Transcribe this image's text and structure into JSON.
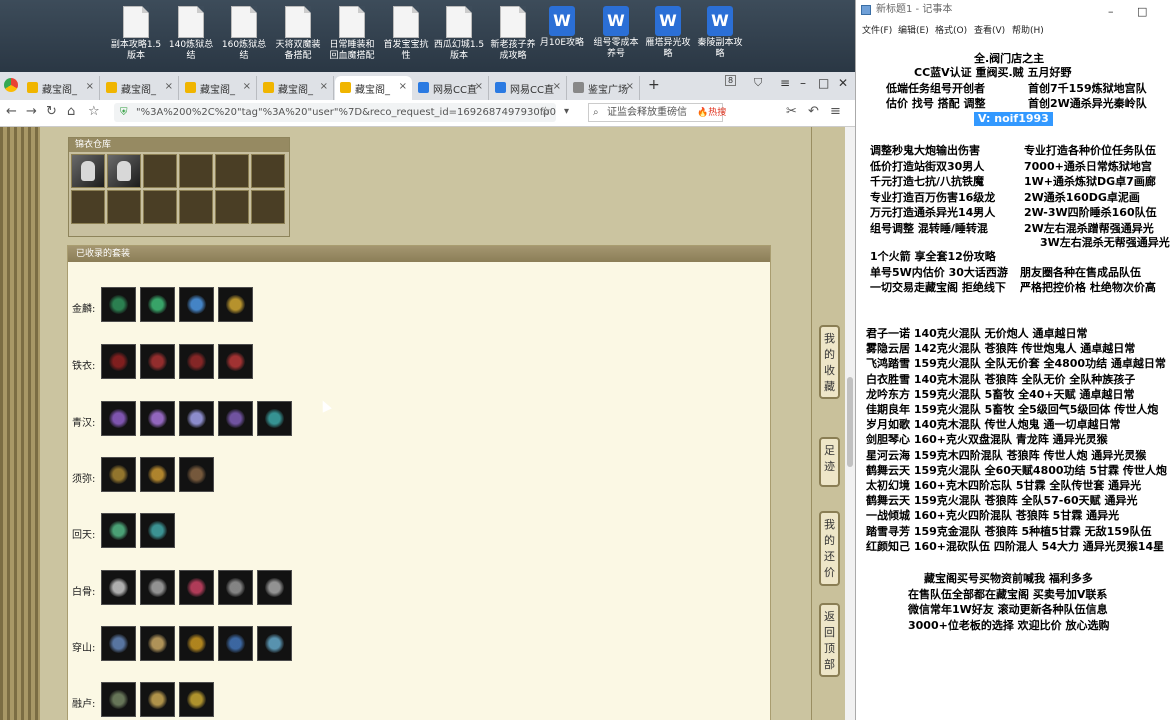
{
  "desktop": {
    "icons": [
      {
        "label": "副本攻略1.5版本",
        "type": "doc"
      },
      {
        "label": "140炼狱总结",
        "type": "doc"
      },
      {
        "label": "160炼狱总结",
        "type": "doc"
      },
      {
        "label": "天将双魔装备搭配",
        "type": "doc"
      },
      {
        "label": "日常睡装和回血魔搭配",
        "type": "doc"
      },
      {
        "label": "首发宝宝抗性",
        "type": "doc"
      },
      {
        "label": "西瓜幻城1.5版本",
        "type": "doc"
      },
      {
        "label": "新老孩子养成攻略",
        "type": "doc"
      },
      {
        "label": "月10E攻略",
        "type": "wps"
      },
      {
        "label": "组号零成本养号",
        "type": "wps"
      },
      {
        "label": "雁塔异光攻略",
        "type": "wps"
      },
      {
        "label": "秦陵副本攻略",
        "type": "wps"
      }
    ]
  },
  "browser": {
    "tabs": [
      {
        "label": "藏宝阁_",
        "active": false
      },
      {
        "label": "藏宝阁_",
        "active": false
      },
      {
        "label": "藏宝阁_",
        "active": false
      },
      {
        "label": "藏宝阁_",
        "active": false
      },
      {
        "label": "藏宝阁_",
        "active": true
      },
      {
        "label": "网易CC直",
        "active": false
      },
      {
        "label": "网易CC直",
        "active": false
      },
      {
        "label": "鉴宝广场",
        "active": false
      }
    ],
    "tab_count": "8",
    "url": "\"%3A%200%2C%20\"tag\"%3A%20\"user\"%7D&reco_request_id=1692687497930fp0oQ",
    "search_placeholder": "证监会释放重磅信",
    "search_hot": "热搜"
  },
  "game": {
    "warehouse_title": "锦衣仓库",
    "warehouse_items": 2,
    "panel_title": "已收录的套装",
    "rows": [
      {
        "label": "金麟:",
        "count": 4,
        "colors": [
          "#2e8b57",
          "#3cb371",
          "#4a90d9",
          "#c8a030"
        ]
      },
      {
        "label": "铁衣:",
        "count": 4,
        "colors": [
          "#8b2020",
          "#a03030",
          "#902828",
          "#b03535"
        ]
      },
      {
        "label": "青汉:",
        "count": 5,
        "colors": [
          "#8a5cc0",
          "#a070d0",
          "#9a9ae0",
          "#7a5ab0",
          "#3aa0a0"
        ]
      },
      {
        "label": "须弥:",
        "count": 3,
        "colors": [
          "#a08030",
          "#c09030",
          "#806040"
        ]
      },
      {
        "label": "回天:",
        "count": 2,
        "colors": [
          "#50b080",
          "#40a0a0"
        ]
      },
      {
        "label": "白骨:",
        "count": 5,
        "colors": [
          "#c0c0c0",
          "#a0a0a0",
          "#c04060",
          "#909090",
          "#a0a0a0"
        ]
      },
      {
        "label": "穿山:",
        "count": 5,
        "colors": [
          "#6080b0",
          "#c0a060",
          "#c09020",
          "#4070b0",
          "#60a0c0"
        ]
      },
      {
        "label": "融卢:",
        "count": 3,
        "colors": [
          "#708060",
          "#c0a050",
          "#c0a030"
        ]
      }
    ],
    "nav": [
      {
        "label": "我的收藏"
      },
      {
        "label": "足迹"
      },
      {
        "label": "我的还价"
      },
      {
        "label": "返回顶部"
      }
    ]
  },
  "notepad": {
    "title": "新标题1 - 记事本",
    "menu": [
      "文件(F)",
      "编辑(E)",
      "格式(O)",
      "查看(V)",
      "帮助(H)"
    ],
    "top_lines": [
      "全.阀门店之主",
      "CC蓝V认证  重阀买.贼  五月好野"
    ],
    "top_pairs": [
      [
        "低端任务组号开创者",
        "首创7千159炼狱地宫队"
      ],
      [
        "估价 找号 搭配 调整",
        "首创2W通杀异光秦岭队"
      ]
    ],
    "vtag": "V:  noif1993",
    "pairs": [
      [
        "调整秒鬼大炮输出伤害",
        "专业打造各种价位任务队伍"
      ],
      [
        "低价打造站街双30男人",
        "7000+通杀日常炼狱地宫"
      ],
      [
        "千元打造七抗/八抗铁魔",
        "1W+通杀炼狱DG卓7画廊"
      ],
      [
        "专业打造百万伤害16级龙",
        "2W通杀160DG卓泥画"
      ],
      [
        "万元打造通杀异光14男人",
        "2W-3W四阶睡杀160队伍"
      ],
      [
        "组号调整 混转睡/睡转混",
        "2W左右混杀蹭帮强通异光"
      ]
    ],
    "pair_tail": "3W左右混杀无帮强通异光",
    "mid_lines": [
      "1个火箭 享全套12份攻略"
    ],
    "mid_pairs": [
      [
        "单号5W内估价 30大话西游",
        "朋友圈各种在售成品队伍"
      ],
      [
        "一切交易走藏宝阁 拒绝线下",
        "严格把控价格 杜绝物次价高"
      ]
    ],
    "list": [
      "君子一诺 140克火混队 无价炮人 通卓越日常",
      "雾隐云居 142克火混队 苍狼阵 传世炮鬼人 通卓越日常",
      "飞鸿踏雪 159克火混队 全队无价套 全4800功结 通卓越日常",
      "白衣胜雪 140克木混队 苍狼阵 全队无价 全队种族孩子",
      "龙吟东方 159克火混队 5畜牧 全40+天赋 通卓越日常",
      "佳期良年 159克火混队 5畜牧 全5级回气5级回体 传世人炮",
      "岁月如歌 140克木混队 传世人炮鬼 通一切卓越日常",
      "剑胆琴心 160+克火双盘混队 青龙阵 通异光灵猴",
      "星河云海 159克木四阶混队 苍狼阵 传世人炮 通异光灵猴",
      "鹤舞云天 159克火混队 全60天赋4800功结 5甘霖 传世人炮",
      "太初幻境 160+克木四阶忘队 5甘霖 全队传世套 通异光",
      "鹤舞云天 159克火混队 苍狼阵 全队57-60天赋 通异光",
      "一战倾城 160+克火四阶混队 苍狼阵 5甘霖 通异光",
      "踏雪寻芳 159克金混队 苍狼阵 5种植5甘霖 无敌159队伍",
      "红颜知己 160+混砍队伍 四阶混人 54大力 通异光灵猴14星"
    ],
    "footer": [
      "藏宝阁买号买物资前喊我 福利多多",
      "在售队伍全部都在藏宝阁 买卖号加V联系",
      "微信常年1W好友 滚动更新各种队伍信息",
      "3000+位老板的选择 欢迎比价 放心选购"
    ]
  }
}
